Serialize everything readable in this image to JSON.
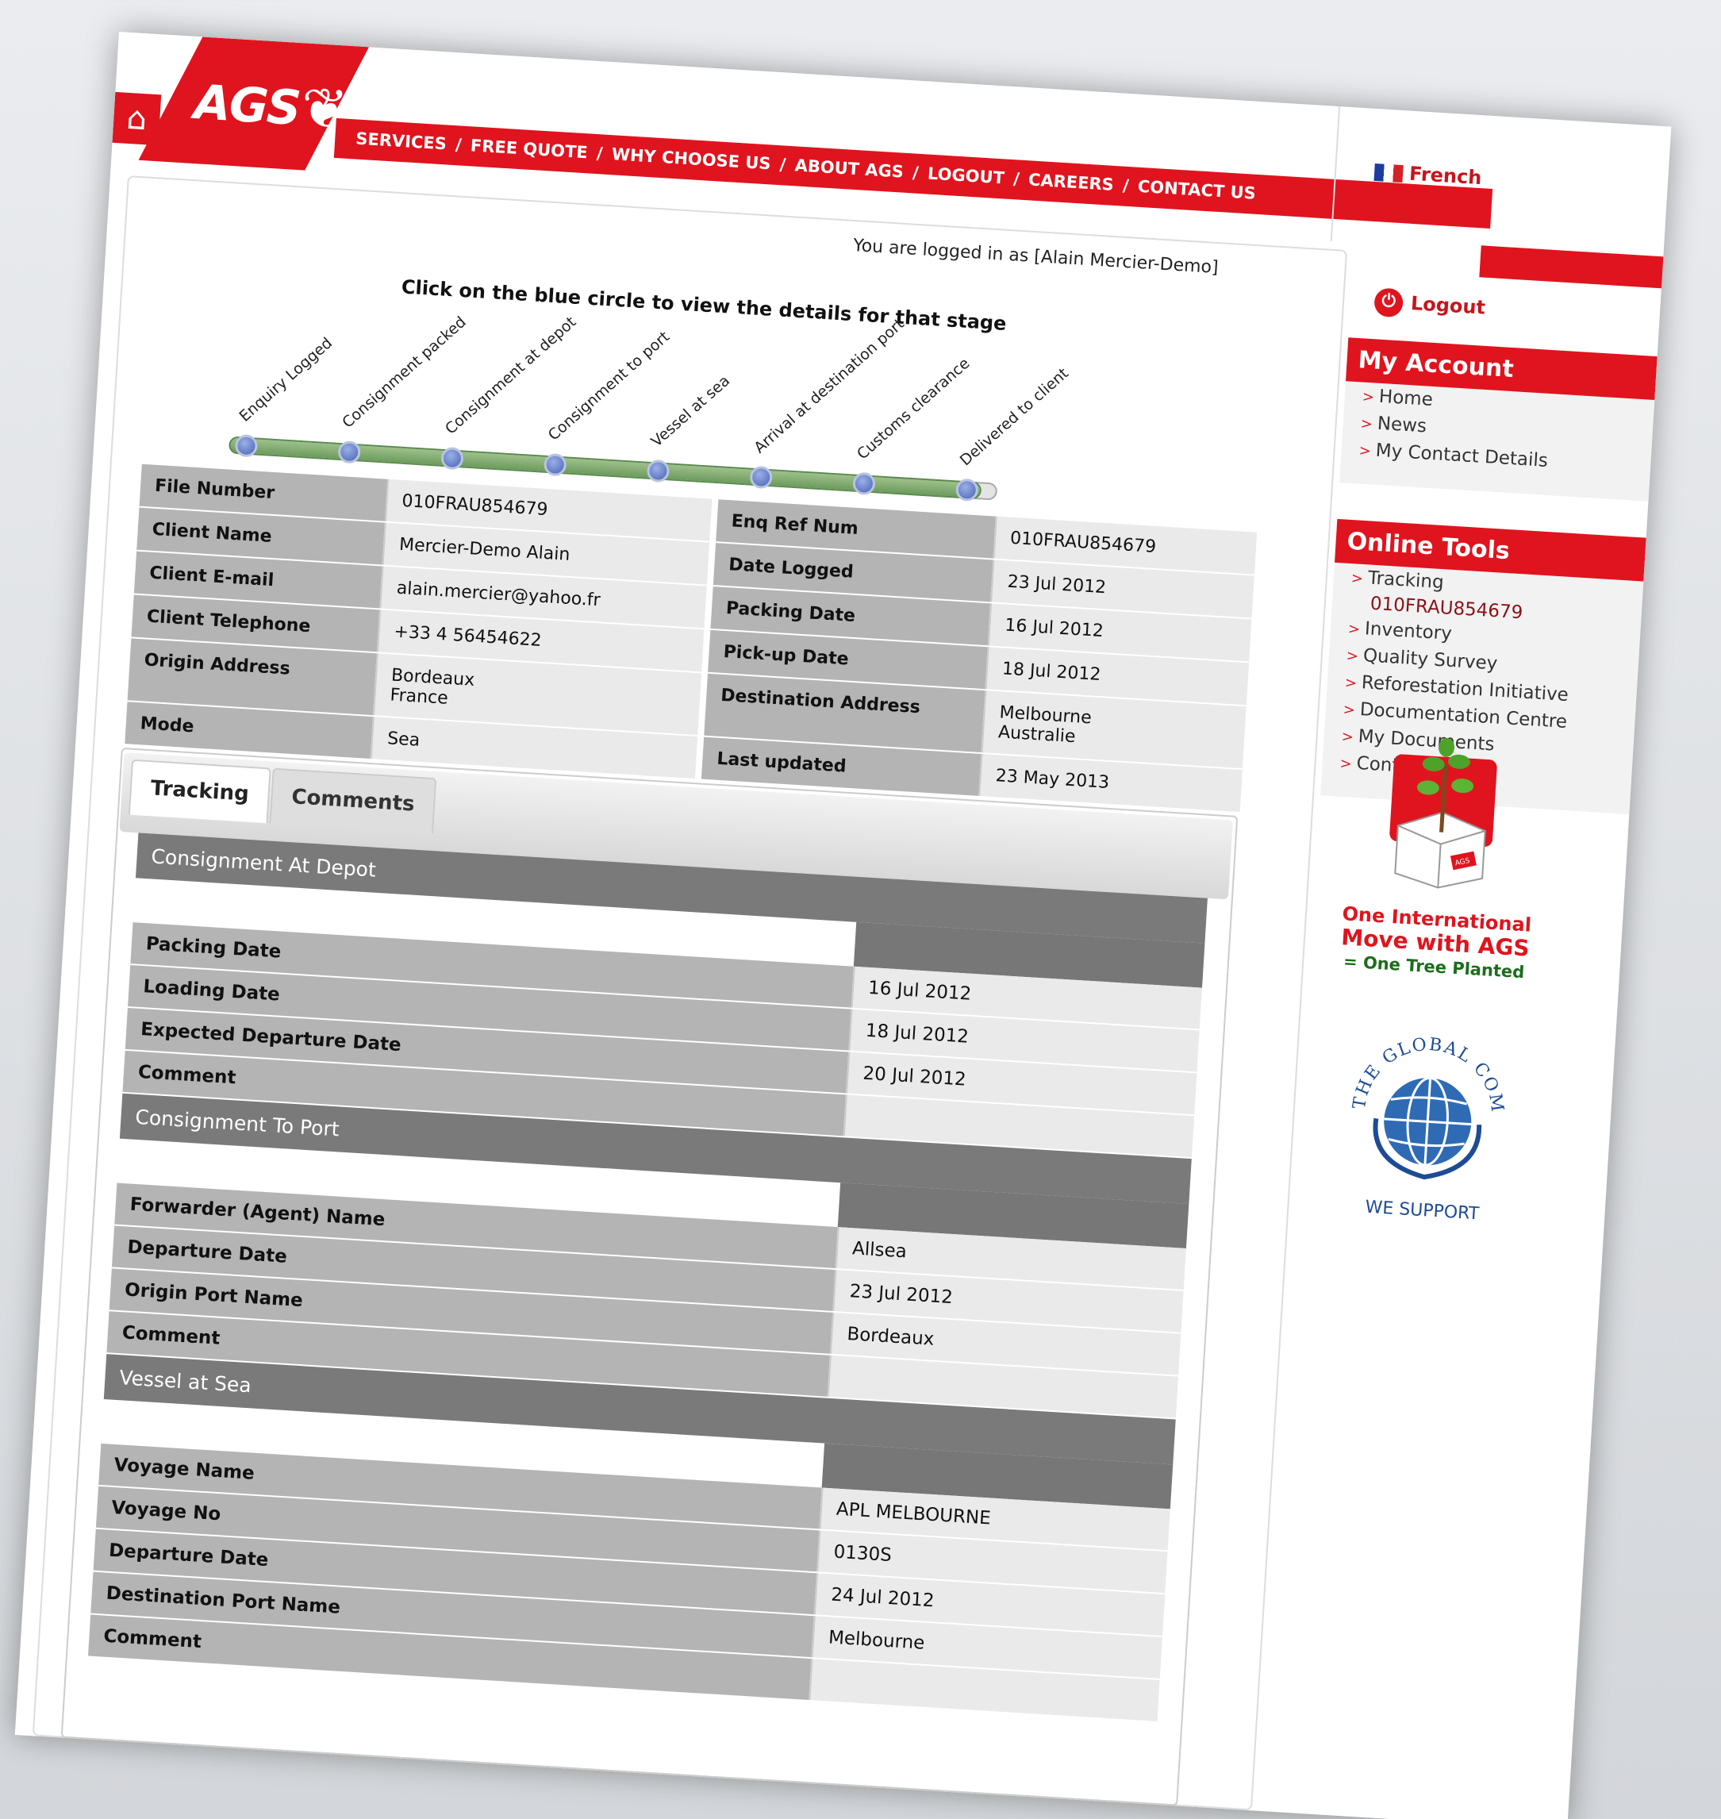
{
  "header": {
    "home_icon": "home-icon",
    "logo": "AGS",
    "nav": [
      "SERVICES",
      "FREE QUOTE",
      "WHY CHOOSE US",
      "ABOUT AGS",
      "LOGOUT",
      "CAREERS",
      "CONTACT US"
    ],
    "nav_separator": " / ",
    "language": "French",
    "logged_in_text": "You are logged in as [Alain Mercier-Demo]",
    "logout": "Logout",
    "brand_color": "#e0141e"
  },
  "tracker": {
    "instruction": "Click on the blue circle to view the details for that stage",
    "stages": [
      "Enquiry Logged",
      "Consignment packed",
      "Consignment at depot",
      "Consignment to port",
      "Vessel at sea",
      "Arrival at destination port",
      "Customs clearance",
      "Delivered to client"
    ],
    "completed_stages": 7
  },
  "info": {
    "left": [
      {
        "label": "File Number",
        "value": "010FRAU854679"
      },
      {
        "label": "Client Name",
        "value": "Mercier-Demo Alain"
      },
      {
        "label": "Client E-mail",
        "value": "alain.mercier@yahoo.fr"
      },
      {
        "label": "Client Telephone",
        "value": "+33 4 56454622"
      },
      {
        "label": "Origin Address",
        "value": "Bordeaux\nFrance"
      },
      {
        "label": "Mode",
        "value": "Sea"
      }
    ],
    "right": [
      {
        "label": "Enq Ref Num",
        "value": "010FRAU854679"
      },
      {
        "label": "Date Logged",
        "value": "23 Jul 2012"
      },
      {
        "label": "Packing Date",
        "value": "16 Jul 2012"
      },
      {
        "label": "Pick-up Date",
        "value": "18 Jul 2012"
      },
      {
        "label": "Destination Address",
        "value": "Melbourne\nAustralie"
      },
      {
        "label": "Last updated",
        "value": "23 May 2013"
      }
    ]
  },
  "tabs": [
    {
      "label": "Tracking",
      "active": true
    },
    {
      "label": "Comments",
      "active": false
    }
  ],
  "tracking_sections": [
    {
      "title": "Consignment At Depot",
      "labels": [
        "Packing Date",
        "Loading Date",
        "Expected Departure Date",
        "Comment"
      ],
      "values": [
        "16 Jul 2012",
        "18 Jul 2012",
        "20 Jul 2012",
        ""
      ]
    },
    {
      "title": "Consignment To Port",
      "labels": [
        "Forwarder (Agent) Name",
        "Departure Date",
        "Origin Port Name",
        "Comment"
      ],
      "values": [
        "Allsea",
        "23 Jul 2012",
        "Bordeaux",
        ""
      ]
    },
    {
      "title": "Vessel at Sea",
      "labels": [
        "Voyage Name",
        "Voyage No",
        "Departure Date",
        "Destination Port Name",
        "Comment"
      ],
      "values": [
        "APL MELBOURNE",
        "0130S",
        "24 Jul 2012",
        "Melbourne",
        ""
      ]
    }
  ],
  "sidebar": {
    "my_account": {
      "title": "My Account",
      "items": [
        "Home",
        "News",
        "My Contact Details"
      ]
    },
    "online_tools": {
      "title": "Online Tools",
      "items": [
        "Tracking",
        "Inventory",
        "Quality Survey",
        "Reforestation Initiative",
        "Documentation Centre",
        "My Documents",
        "Contact Us"
      ],
      "tracking_ref": "010FRAU854679"
    }
  },
  "promo": {
    "line1": "One International",
    "line2": "Move with AGS",
    "line3": "= One Tree Planted",
    "box_label": "AGS",
    "global_compact": "THE GLOBAL COMPACT",
    "we_support": "WE SUPPORT"
  }
}
